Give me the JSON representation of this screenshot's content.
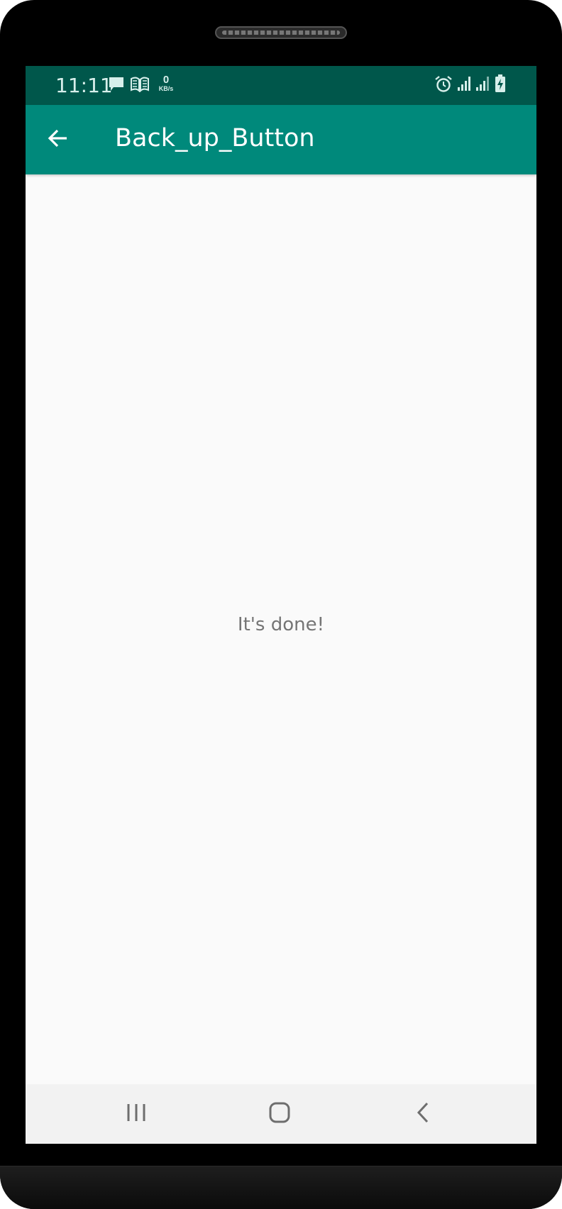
{
  "status_bar": {
    "time": "11:11",
    "speed_value": "0",
    "speed_unit": "KB/s",
    "icons": [
      "message-icon",
      "book-icon",
      "alarm-icon",
      "signal-icon",
      "signal-icon",
      "battery-charging-icon"
    ]
  },
  "app_bar": {
    "title": "Back_up_Button",
    "back_icon": "arrow-back-icon"
  },
  "main": {
    "message": "It's done!"
  },
  "nav_bar": {
    "icons": [
      "recents-icon",
      "home-icon",
      "back-icon"
    ]
  },
  "colors": {
    "status_bar": "#00574b",
    "app_bar": "#00897b",
    "background": "#fafafa",
    "message_text": "#757575",
    "nav_bar": "#f2f2f2"
  }
}
